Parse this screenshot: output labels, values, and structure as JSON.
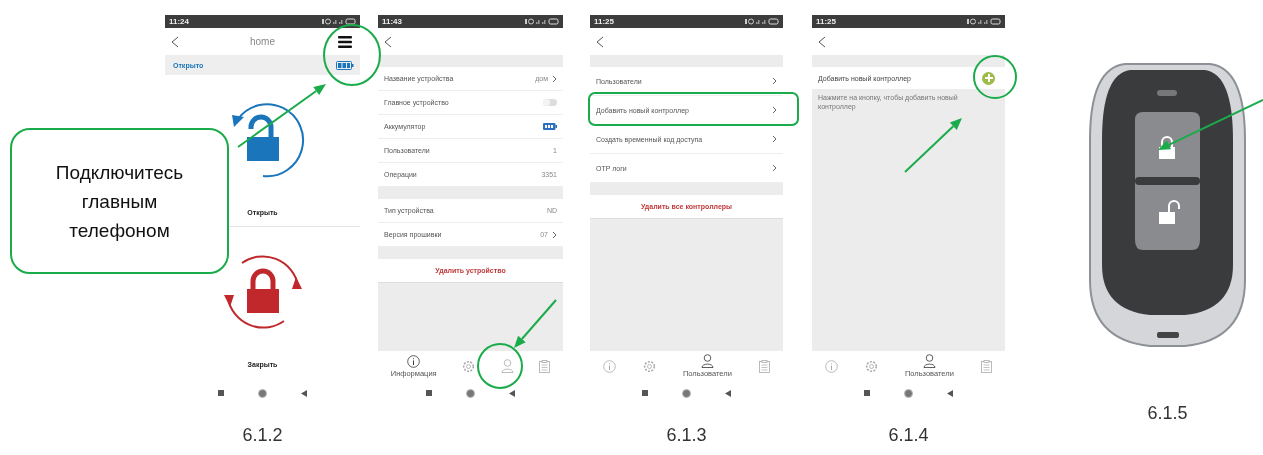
{
  "screens": [
    {
      "kind": "home",
      "status_time": "11:24",
      "title": "home",
      "state_label": "Открыто",
      "actions": [
        {
          "kind": "unlock",
          "label": "Открыть"
        },
        {
          "kind": "lock",
          "label": "Закрыть"
        }
      ],
      "caption": "6.1.2"
    },
    {
      "kind": "list",
      "status_time": "11:43",
      "groups": [
        [
          {
            "kind": "link",
            "label": "Название устройства",
            "value": "дом"
          },
          {
            "kind": "toggle",
            "label": "Главное устройство",
            "on": false
          },
          {
            "kind": "battery",
            "label": "Аккумулятор"
          },
          {
            "kind": "value",
            "label": "Пользователи",
            "value": "1"
          },
          {
            "kind": "value",
            "label": "Операции",
            "value": "3351"
          }
        ],
        [
          {
            "kind": "value",
            "label": "Тип устройства",
            "value": "ND"
          },
          {
            "kind": "link",
            "label": "Версия прошивки",
            "value": "07"
          }
        ]
      ],
      "danger_button": "Удалить устройство",
      "tabs": [
        {
          "kind": "info",
          "selected": true,
          "label": "Информация"
        },
        {
          "kind": "gear",
          "selected": false
        },
        {
          "kind": "user",
          "selected": false
        },
        {
          "kind": "clipboard",
          "selected": false
        }
      ]
    },
    {
      "kind": "list",
      "status_time": "11:25",
      "groups": [
        [
          {
            "kind": "link",
            "label": "Пользователи"
          },
          {
            "kind": "link",
            "label": "Добавить новый контроллер"
          },
          {
            "kind": "link",
            "label": "Создать временный код доступа"
          },
          {
            "kind": "link",
            "label": "OTP логи"
          }
        ]
      ],
      "danger_button": "Удалить все контроллеры",
      "tabs": [
        {
          "kind": "info",
          "selected": false
        },
        {
          "kind": "gear",
          "selected": false
        },
        {
          "kind": "user",
          "selected": true,
          "label": "Пользователи"
        },
        {
          "kind": "clipboard",
          "selected": false
        }
      ],
      "caption": "6.1.3"
    },
    {
      "kind": "add",
      "status_time": "11:25",
      "row_label": "Добавить новый контроллер",
      "hint": "Нажмите на кнопку, чтобы добавить новый контроллер",
      "tabs": [
        {
          "kind": "info",
          "selected": false
        },
        {
          "kind": "gear",
          "selected": false
        },
        {
          "kind": "user",
          "selected": true,
          "label": "Пользователи"
        },
        {
          "kind": "clipboard",
          "selected": false
        }
      ],
      "caption": "6.1.4"
    }
  ],
  "callout": "Подключитесь\nглавным\nтелефоном",
  "key_fob": {
    "caption": "6.1.5"
  }
}
